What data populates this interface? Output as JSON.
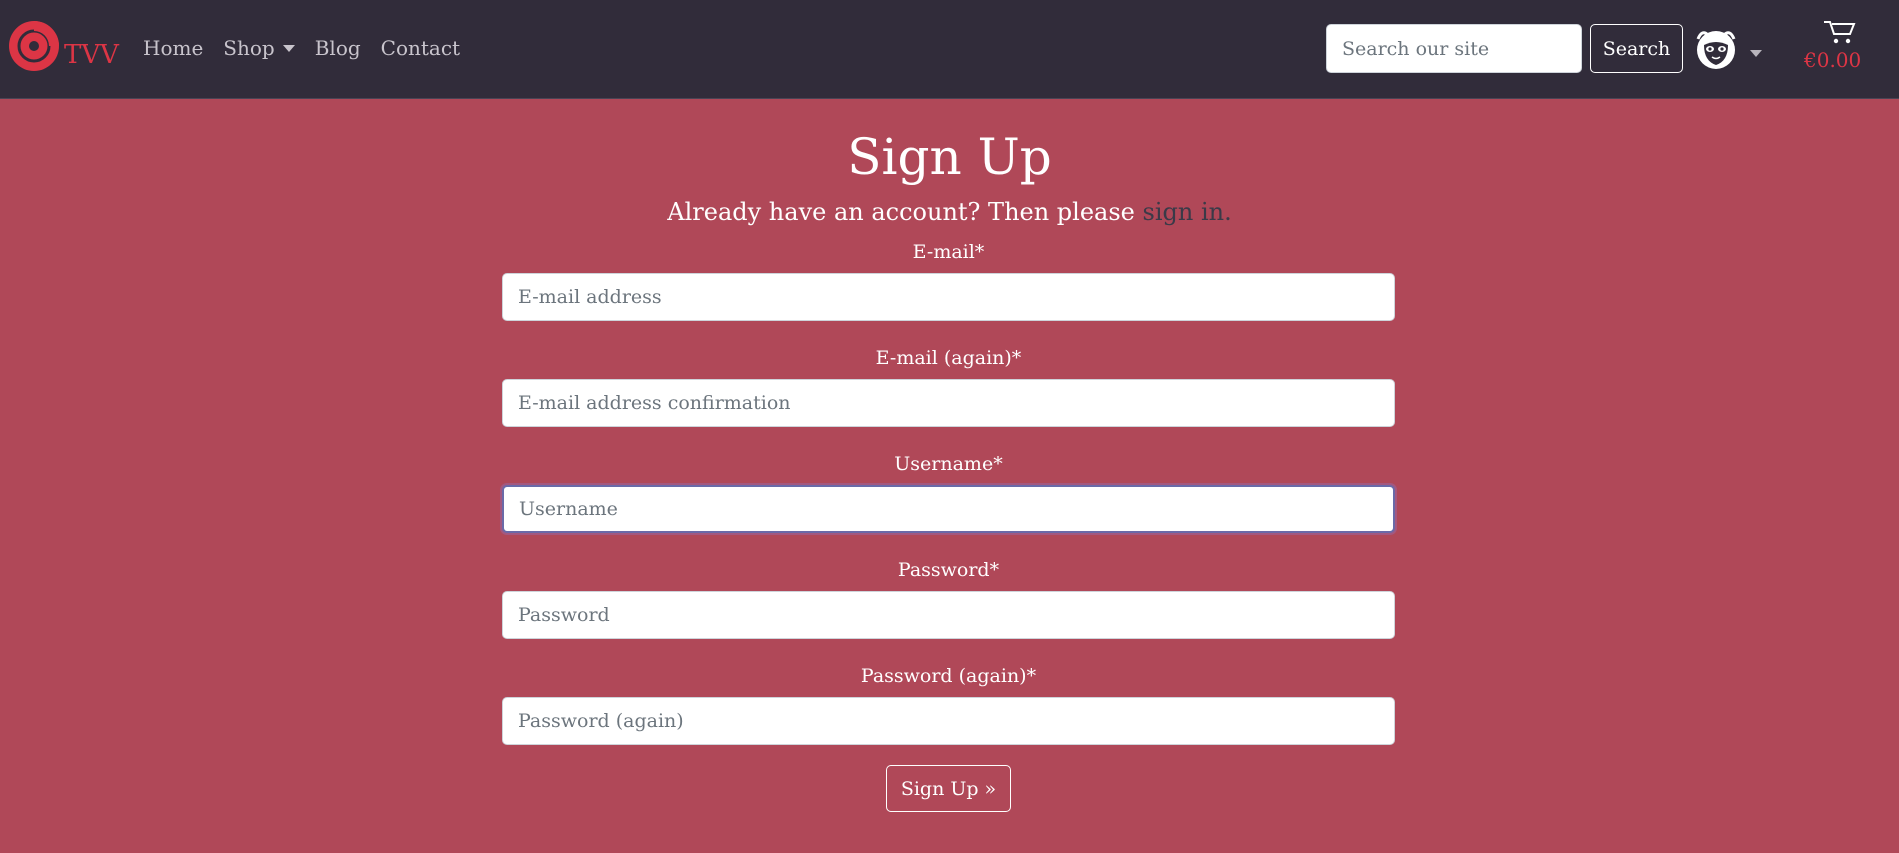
{
  "brand": {
    "name": "TVV",
    "accent_color": "#dc3545"
  },
  "nav": {
    "items": [
      {
        "label": "Home"
      },
      {
        "label": "Shop",
        "has_dropdown": true
      },
      {
        "label": "Blog"
      },
      {
        "label": "Contact"
      }
    ]
  },
  "search": {
    "placeholder": "Search our site",
    "button_label": "Search"
  },
  "account": {
    "icon": "napster-cat-avatar-icon"
  },
  "cart": {
    "icon": "shopping-cart-icon",
    "total": "€0.00"
  },
  "page": {
    "title": "Sign Up",
    "subtitle_text": "Already have an account? Then please",
    "signin_link": "sign in."
  },
  "form": {
    "fields": [
      {
        "label": "E-mail*",
        "placeholder": "E-mail address",
        "value": ""
      },
      {
        "label": "E-mail (again)*",
        "placeholder": "E-mail address confirmation",
        "value": ""
      },
      {
        "label": "Username*",
        "placeholder": "Username",
        "value": "",
        "focused": true
      },
      {
        "label": "Password*",
        "placeholder": "Password",
        "value": ""
      },
      {
        "label": "Password (again)*",
        "placeholder": "Password (again)",
        "value": ""
      }
    ],
    "submit_label": "Sign Up »"
  },
  "colors": {
    "navbar": "#312c3a",
    "background": "#b04858",
    "link": "#3a3a48"
  }
}
